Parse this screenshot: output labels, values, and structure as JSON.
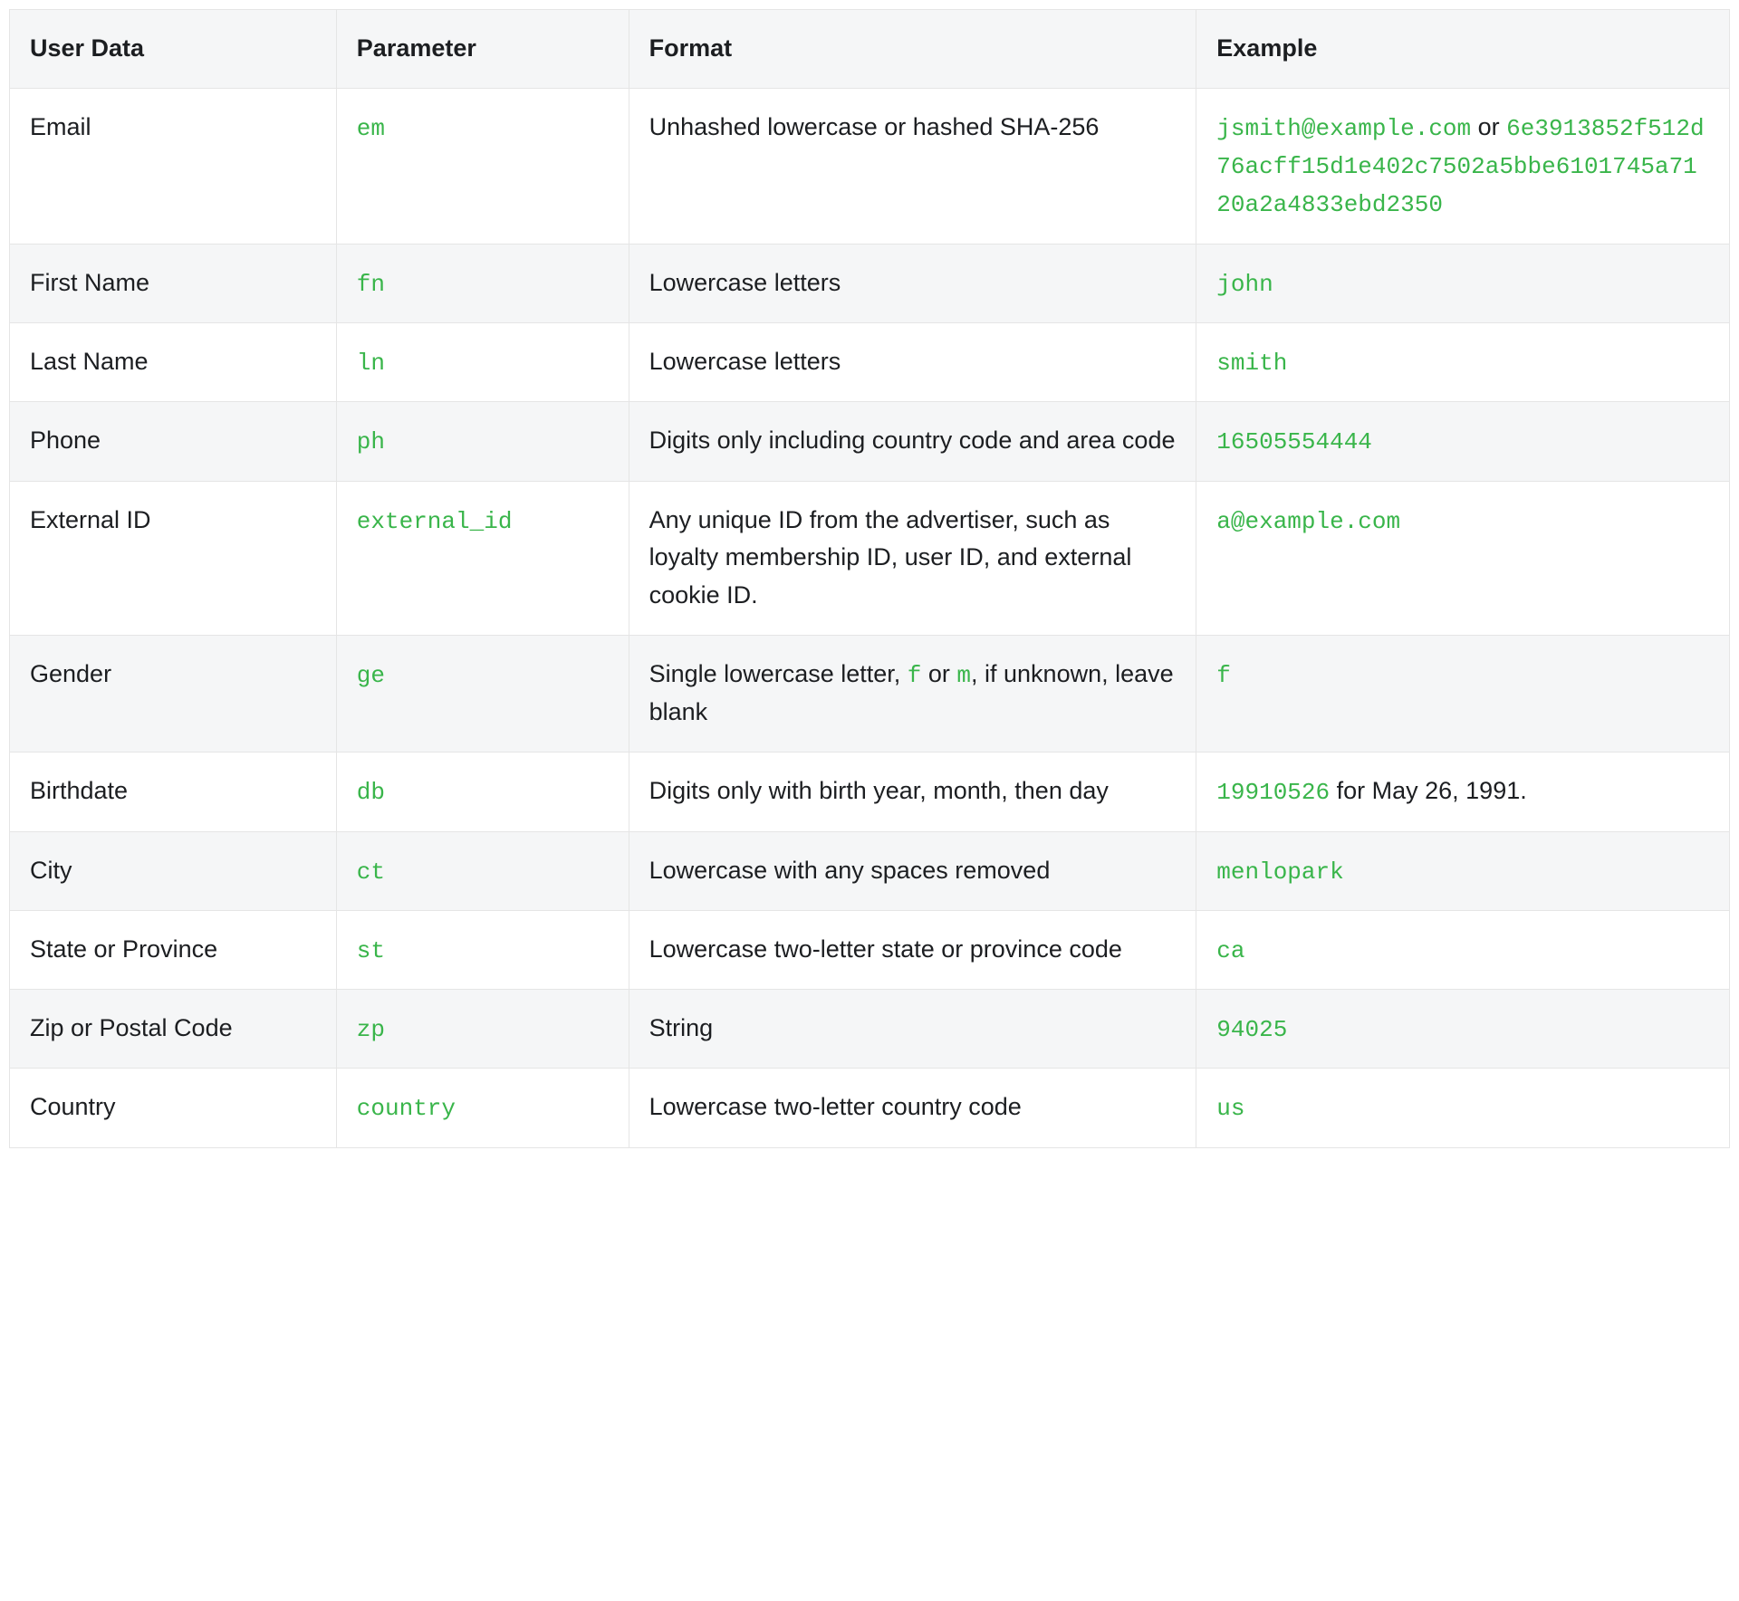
{
  "table": {
    "headers": {
      "user_data": "User Data",
      "parameter": "Parameter",
      "format": "Format",
      "example": "Example"
    },
    "rows": [
      {
        "user_data": "Email",
        "parameter": "em",
        "format": {
          "text": "Unhashed lowercase or hashed SHA-256"
        },
        "example": {
          "code1": "jsmith@example.com",
          "sep": " or ",
          "code2": "6e3913852f512d76acff15d1e402c7502a5bbe6101745a7120a2a4833ebd2350"
        }
      },
      {
        "user_data": "First Name",
        "parameter": "fn",
        "format": {
          "text": "Lowercase letters"
        },
        "example": {
          "code1": "john"
        }
      },
      {
        "user_data": "Last Name",
        "parameter": "ln",
        "format": {
          "text": "Lowercase letters"
        },
        "example": {
          "code1": "smith"
        }
      },
      {
        "user_data": "Phone",
        "parameter": "ph",
        "format": {
          "text": "Digits only including country code and area code"
        },
        "example": {
          "code1": "16505554444"
        }
      },
      {
        "user_data": "External ID",
        "parameter": "external_id",
        "format": {
          "text": "Any unique ID from the advertiser, such as loyalty membership ID, user ID, and external cookie ID."
        },
        "example": {
          "code1": "a@example.com"
        }
      },
      {
        "user_data": "Gender",
        "parameter": "ge",
        "format": {
          "pre": "Single lowercase letter, ",
          "code1": "f",
          "mid": " or ",
          "code2": "m",
          "post": ", if unknown, leave blank"
        },
        "example": {
          "code1": "f"
        }
      },
      {
        "user_data": "Birthdate",
        "parameter": "db",
        "format": {
          "text": "Digits only with birth year, month, then day"
        },
        "example": {
          "code1": "19910526",
          "suffix": " for May 26, 1991."
        }
      },
      {
        "user_data": "City",
        "parameter": "ct",
        "format": {
          "text": "Lowercase with any spaces removed"
        },
        "example": {
          "code1": "menlopark"
        }
      },
      {
        "user_data": "State or Province",
        "parameter": "st",
        "format": {
          "text": "Lowercase two-letter state or province code"
        },
        "example": {
          "code1": "ca"
        }
      },
      {
        "user_data": "Zip or Postal Code",
        "parameter": "zp",
        "format": {
          "text": "String"
        },
        "example": {
          "code1": "94025"
        }
      },
      {
        "user_data": "Country",
        "parameter": "country",
        "format": {
          "text": "Lowercase two-letter country code"
        },
        "example": {
          "code1": "us"
        }
      }
    ]
  }
}
